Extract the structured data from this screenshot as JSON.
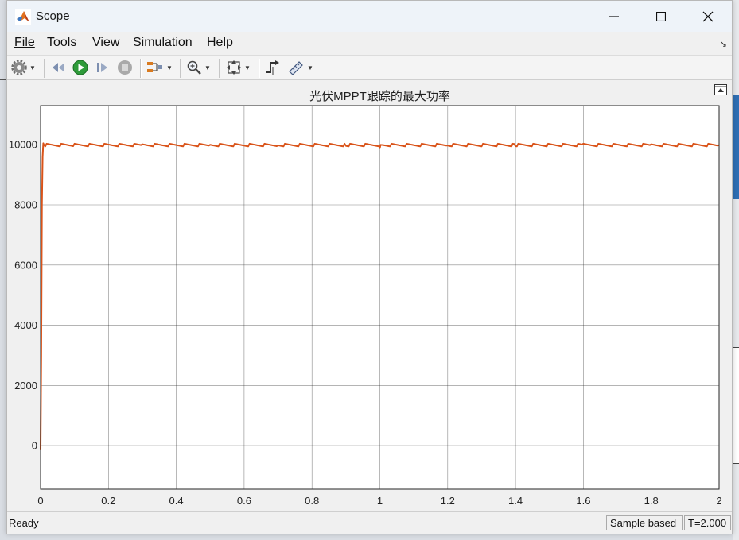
{
  "window": {
    "title": "Scope",
    "minimize_label": "minimize",
    "maximize_label": "maximize",
    "close_label": "close"
  },
  "menu": {
    "file": "File",
    "tools": "Tools",
    "view": "View",
    "simulation": "Simulation",
    "help": "Help"
  },
  "toolbar": {
    "icons": [
      "gear-icon",
      "step-back-icon",
      "run-icon",
      "step-forward-icon",
      "stop-icon",
      "signal-select-icon",
      "zoom-in-icon",
      "fit-axes-icon",
      "triggers-icon",
      "measurements-icon"
    ]
  },
  "status": {
    "ready": "Ready",
    "sample_mode": "Sample based",
    "time": "T=2.000"
  },
  "colors": {
    "trace": "#d95319",
    "grid": "#262626",
    "axes_bg": "#ffffff"
  },
  "chart_data": {
    "type": "line",
    "title": "光伏MPPT跟踪的最大功率",
    "xlabel": "",
    "ylabel": "",
    "xlim": [
      0,
      2
    ],
    "ylim": [
      -1450,
      11300
    ],
    "grid": true,
    "x_ticks": [
      0,
      0.2,
      0.4,
      0.6,
      0.8,
      1,
      1.2,
      1.4,
      1.6,
      1.8,
      2
    ],
    "x_tick_labels": [
      "0",
      "0.2",
      "0.4",
      "0.6",
      "0.8",
      "1",
      "1.2",
      "1.4",
      "1.6",
      "1.8",
      "2"
    ],
    "y_ticks": [
      0,
      2000,
      4000,
      6000,
      8000,
      10000
    ],
    "y_tick_labels": [
      "0",
      "2000",
      "4000",
      "6000",
      "8000",
      "10000"
    ],
    "series": [
      {
        "color": "#d95319",
        "x": [
          0,
          0.002,
          0.004,
          0.006,
          0.008,
          0.01,
          0.1,
          0.3,
          0.5,
          0.7,
          0.9,
          0.998,
          1.0,
          1.002,
          1.01,
          1.2,
          1.4,
          1.6,
          1.8,
          2.0
        ],
        "y": [
          -150,
          3000,
          8000,
          9600,
          10050,
          9990,
          9990,
          9990,
          9990,
          9990,
          9990,
          9990,
          9850,
          9980,
          9990,
          9990,
          9990,
          9990,
          9990,
          9990
        ]
      }
    ]
  }
}
